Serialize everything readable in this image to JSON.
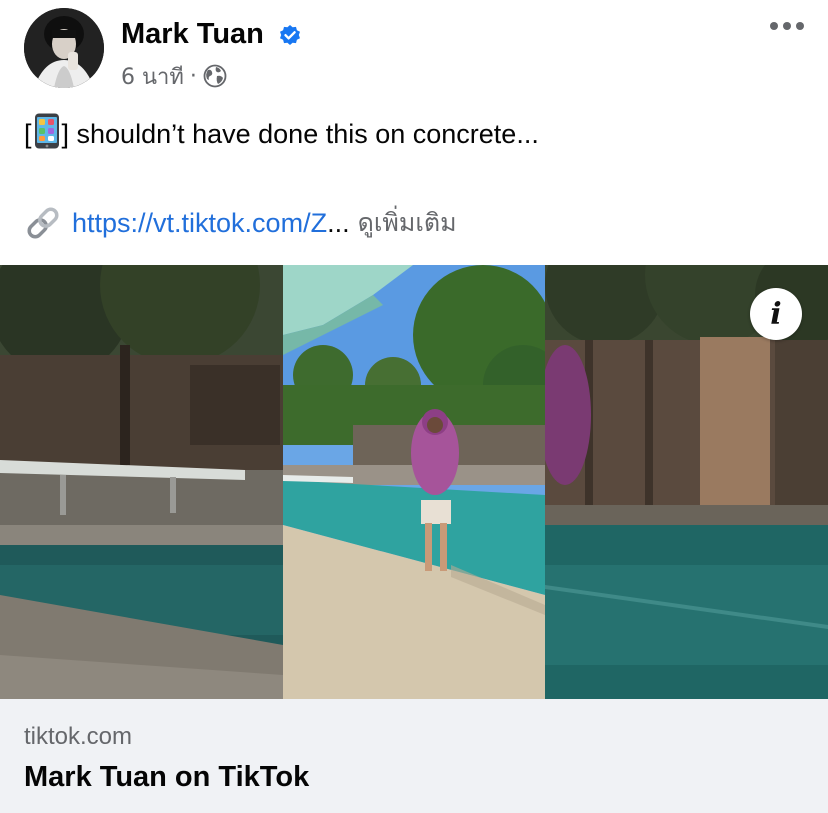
{
  "post": {
    "author": "Mark Tuan",
    "time": "6 นาที",
    "separator": "·",
    "text_open": "[",
    "text_rest": "] shouldn’t have done this on concrete...",
    "link_url": "https://vt.tiktok.com/Z",
    "link_ellipsis": "...",
    "see_more": "ดูเพิ่มเติม"
  },
  "link_preview": {
    "domain": "tiktok.com",
    "title": "Mark Tuan on TikTok"
  },
  "icons": {
    "verified": "verified-badge-icon",
    "audience": "globe-icon",
    "menu": "more-options-icon",
    "link": "link-icon",
    "emoji": "mobile-phone-emoji",
    "info": "info-icon"
  },
  "media": {
    "info_label": "i"
  },
  "colors": {
    "link": "#216fdb",
    "verified": "#1877f2",
    "secondary_text": "#65676b",
    "card_background": "#f0f2f5"
  }
}
